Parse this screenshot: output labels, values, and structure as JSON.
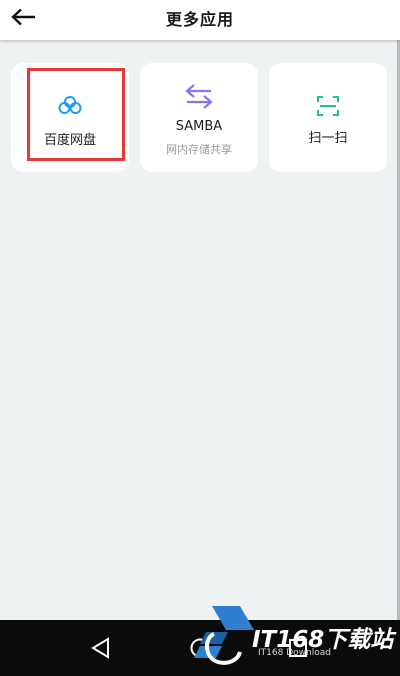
{
  "header": {
    "title": "更多应用"
  },
  "apps": [
    {
      "label": "百度网盘",
      "icon": "cloud-icon",
      "color": "#1e9af0"
    },
    {
      "label": "SAMBA",
      "sub": "网内存储共享",
      "icon": "transfer-arrows-icon",
      "color": "#8a73f0"
    },
    {
      "label": "扫一扫",
      "icon": "scan-icon",
      "color": "#1bbf9a"
    }
  ],
  "watermark": {
    "text": "IT168下载站",
    "sub": "IT168 Download"
  },
  "colors": {
    "background": "#eff2f3",
    "highlight": "#e53935",
    "navbar": "#0b0b0b"
  }
}
